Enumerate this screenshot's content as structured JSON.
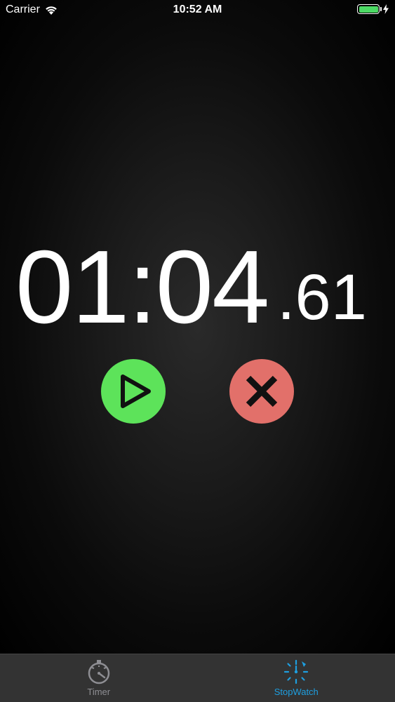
{
  "status_bar": {
    "carrier": "Carrier",
    "time": "10:52 AM",
    "battery_color": "#4cd964"
  },
  "stopwatch": {
    "main_time": "01:04",
    "hundredths": ".61"
  },
  "controls": {
    "play_color": "#5de35a",
    "play_icon": "play-icon",
    "cancel_color": "#e2706a",
    "cancel_icon": "close-icon"
  },
  "tab_bar": {
    "tabs": [
      {
        "label": "Timer",
        "icon": "timer-icon",
        "color": "#8e8e93",
        "selected": false
      },
      {
        "label": "StopWatch",
        "icon": "stopwatch-icon",
        "color": "#1e9fe0",
        "selected": true
      }
    ]
  }
}
